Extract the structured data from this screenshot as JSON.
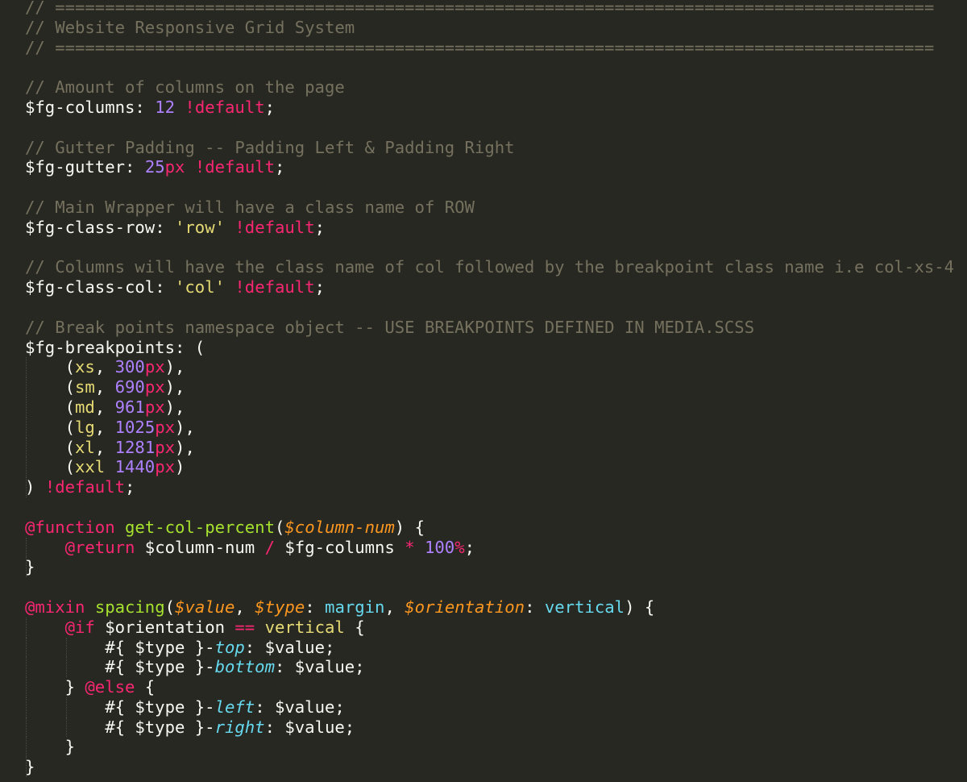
{
  "editor": {
    "language": "scss",
    "theme_colors": {
      "background": "#272822",
      "comment": "#75715e",
      "number": "#ae81ff",
      "keyword": "#f92672",
      "string": "#e6db74",
      "function": "#a6e22e",
      "parameter": "#fd971f",
      "constant": "#66d9ef",
      "plain": "#f8f8f2"
    },
    "lines": [
      [
        {
          "t": "comment",
          "v": "// ========================================================================================"
        }
      ],
      [
        {
          "t": "comment",
          "v": "// Website Responsive Grid System"
        }
      ],
      [
        {
          "t": "comment",
          "v": "// ========================================================================================"
        }
      ],
      [],
      [
        {
          "t": "comment",
          "v": "// Amount of columns on the page"
        }
      ],
      [
        {
          "t": "var",
          "v": "$fg-columns"
        },
        {
          "t": "plain",
          "v": ": "
        },
        {
          "t": "num",
          "v": "12"
        },
        {
          "t": "plain",
          "v": " "
        },
        {
          "t": "kw",
          "v": "!default"
        },
        {
          "t": "plain",
          "v": ";"
        }
      ],
      [],
      [
        {
          "t": "comment",
          "v": "// Gutter Padding -- Padding Left & Padding Right"
        }
      ],
      [
        {
          "t": "var",
          "v": "$fg-gutter"
        },
        {
          "t": "plain",
          "v": ": "
        },
        {
          "t": "num",
          "v": "25"
        },
        {
          "t": "unit",
          "v": "px"
        },
        {
          "t": "plain",
          "v": " "
        },
        {
          "t": "kw",
          "v": "!default"
        },
        {
          "t": "plain",
          "v": ";"
        }
      ],
      [],
      [
        {
          "t": "comment",
          "v": "// Main Wrapper will have a class name of ROW"
        }
      ],
      [
        {
          "t": "var",
          "v": "$fg-class-row"
        },
        {
          "t": "plain",
          "v": ": "
        },
        {
          "t": "str",
          "v": "'row'"
        },
        {
          "t": "plain",
          "v": " "
        },
        {
          "t": "kw",
          "v": "!default"
        },
        {
          "t": "plain",
          "v": ";"
        }
      ],
      [],
      [
        {
          "t": "comment",
          "v": "// Columns will have the class name of col followed by the breakpoint class name i.e col-xs-4"
        }
      ],
      [
        {
          "t": "var",
          "v": "$fg-class-col"
        },
        {
          "t": "plain",
          "v": ": "
        },
        {
          "t": "str",
          "v": "'col'"
        },
        {
          "t": "plain",
          "v": " "
        },
        {
          "t": "kw",
          "v": "!default"
        },
        {
          "t": "plain",
          "v": ";"
        }
      ],
      [],
      [
        {
          "t": "comment",
          "v": "// Break points namespace object -- USE BREAKPOINTS DEFINED IN MEDIA.SCSS"
        }
      ],
      [
        {
          "t": "var",
          "v": "$fg-breakpoints"
        },
        {
          "t": "plain",
          "v": ": ("
        }
      ],
      [
        {
          "t": "plain",
          "v": "    ("
        },
        {
          "t": "str",
          "v": "xs"
        },
        {
          "t": "plain",
          "v": ", "
        },
        {
          "t": "num",
          "v": "300"
        },
        {
          "t": "unit",
          "v": "px"
        },
        {
          "t": "plain",
          "v": "),"
        }
      ],
      [
        {
          "t": "plain",
          "v": "    ("
        },
        {
          "t": "str",
          "v": "sm"
        },
        {
          "t": "plain",
          "v": ", "
        },
        {
          "t": "num",
          "v": "690"
        },
        {
          "t": "unit",
          "v": "px"
        },
        {
          "t": "plain",
          "v": "),"
        }
      ],
      [
        {
          "t": "plain",
          "v": "    ("
        },
        {
          "t": "str",
          "v": "md"
        },
        {
          "t": "plain",
          "v": ", "
        },
        {
          "t": "num",
          "v": "961"
        },
        {
          "t": "unit",
          "v": "px"
        },
        {
          "t": "plain",
          "v": "),"
        }
      ],
      [
        {
          "t": "plain",
          "v": "    ("
        },
        {
          "t": "str",
          "v": "lg"
        },
        {
          "t": "plain",
          "v": ", "
        },
        {
          "t": "num",
          "v": "1025"
        },
        {
          "t": "unit",
          "v": "px"
        },
        {
          "t": "plain",
          "v": "),"
        }
      ],
      [
        {
          "t": "plain",
          "v": "    ("
        },
        {
          "t": "str",
          "v": "xl"
        },
        {
          "t": "plain",
          "v": ", "
        },
        {
          "t": "num",
          "v": "1281"
        },
        {
          "t": "unit",
          "v": "px"
        },
        {
          "t": "plain",
          "v": "),"
        }
      ],
      [
        {
          "t": "plain",
          "v": "    ("
        },
        {
          "t": "str",
          "v": "xxl"
        },
        {
          "t": "plain",
          "v": " "
        },
        {
          "t": "num",
          "v": "1440"
        },
        {
          "t": "unit",
          "v": "px"
        },
        {
          "t": "plain",
          "v": ")"
        }
      ],
      [
        {
          "t": "plain",
          "v": ") "
        },
        {
          "t": "kw",
          "v": "!default"
        },
        {
          "t": "plain",
          "v": ";"
        }
      ],
      [],
      [
        {
          "t": "kw",
          "v": "@function"
        },
        {
          "t": "plain",
          "v": " "
        },
        {
          "t": "fn",
          "v": "get-col-percent"
        },
        {
          "t": "plain",
          "v": "("
        },
        {
          "t": "param",
          "v": "$column-num"
        },
        {
          "t": "plain",
          "v": ") {"
        }
      ],
      [
        {
          "t": "plain",
          "v": "    "
        },
        {
          "t": "kw",
          "v": "@return"
        },
        {
          "t": "plain",
          "v": " $column-num "
        },
        {
          "t": "kw",
          "v": "/"
        },
        {
          "t": "plain",
          "v": " $fg-columns "
        },
        {
          "t": "kw",
          "v": "*"
        },
        {
          "t": "plain",
          "v": " "
        },
        {
          "t": "num",
          "v": "100"
        },
        {
          "t": "unit",
          "v": "%"
        },
        {
          "t": "plain",
          "v": ";"
        }
      ],
      [
        {
          "t": "plain",
          "v": "}"
        }
      ],
      [],
      [
        {
          "t": "kw",
          "v": "@mixin"
        },
        {
          "t": "plain",
          "v": " "
        },
        {
          "t": "fn",
          "v": "spacing"
        },
        {
          "t": "plain",
          "v": "("
        },
        {
          "t": "param",
          "v": "$value"
        },
        {
          "t": "plain",
          "v": ", "
        },
        {
          "t": "param",
          "v": "$type"
        },
        {
          "t": "plain",
          "v": ": "
        },
        {
          "t": "const",
          "v": "margin"
        },
        {
          "t": "plain",
          "v": ", "
        },
        {
          "t": "param",
          "v": "$orientation"
        },
        {
          "t": "plain",
          "v": ": "
        },
        {
          "t": "const",
          "v": "vertical"
        },
        {
          "t": "plain",
          "v": ") {"
        }
      ],
      [
        {
          "t": "plain",
          "v": "    "
        },
        {
          "t": "kw",
          "v": "@if"
        },
        {
          "t": "plain",
          "v": " $orientation "
        },
        {
          "t": "kw",
          "v": "=="
        },
        {
          "t": "plain",
          "v": " "
        },
        {
          "t": "str",
          "v": "vertical"
        },
        {
          "t": "plain",
          "v": " {"
        }
      ],
      [
        {
          "t": "plain",
          "v": "        #{ $type }-"
        },
        {
          "t": "prop",
          "v": "top"
        },
        {
          "t": "plain",
          "v": ": $value;"
        }
      ],
      [
        {
          "t": "plain",
          "v": "        #{ $type }-"
        },
        {
          "t": "prop",
          "v": "bottom"
        },
        {
          "t": "plain",
          "v": ": $value;"
        }
      ],
      [
        {
          "t": "plain",
          "v": "    } "
        },
        {
          "t": "kw",
          "v": "@else"
        },
        {
          "t": "plain",
          "v": " {"
        }
      ],
      [
        {
          "t": "plain",
          "v": "        #{ $type }-"
        },
        {
          "t": "prop",
          "v": "left"
        },
        {
          "t": "plain",
          "v": ": $value;"
        }
      ],
      [
        {
          "t": "plain",
          "v": "        #{ $type }-"
        },
        {
          "t": "prop",
          "v": "right"
        },
        {
          "t": "plain",
          "v": ": $value;"
        }
      ],
      [
        {
          "t": "plain",
          "v": "    }"
        }
      ],
      [
        {
          "t": "plain",
          "v": "}"
        }
      ]
    ]
  }
}
